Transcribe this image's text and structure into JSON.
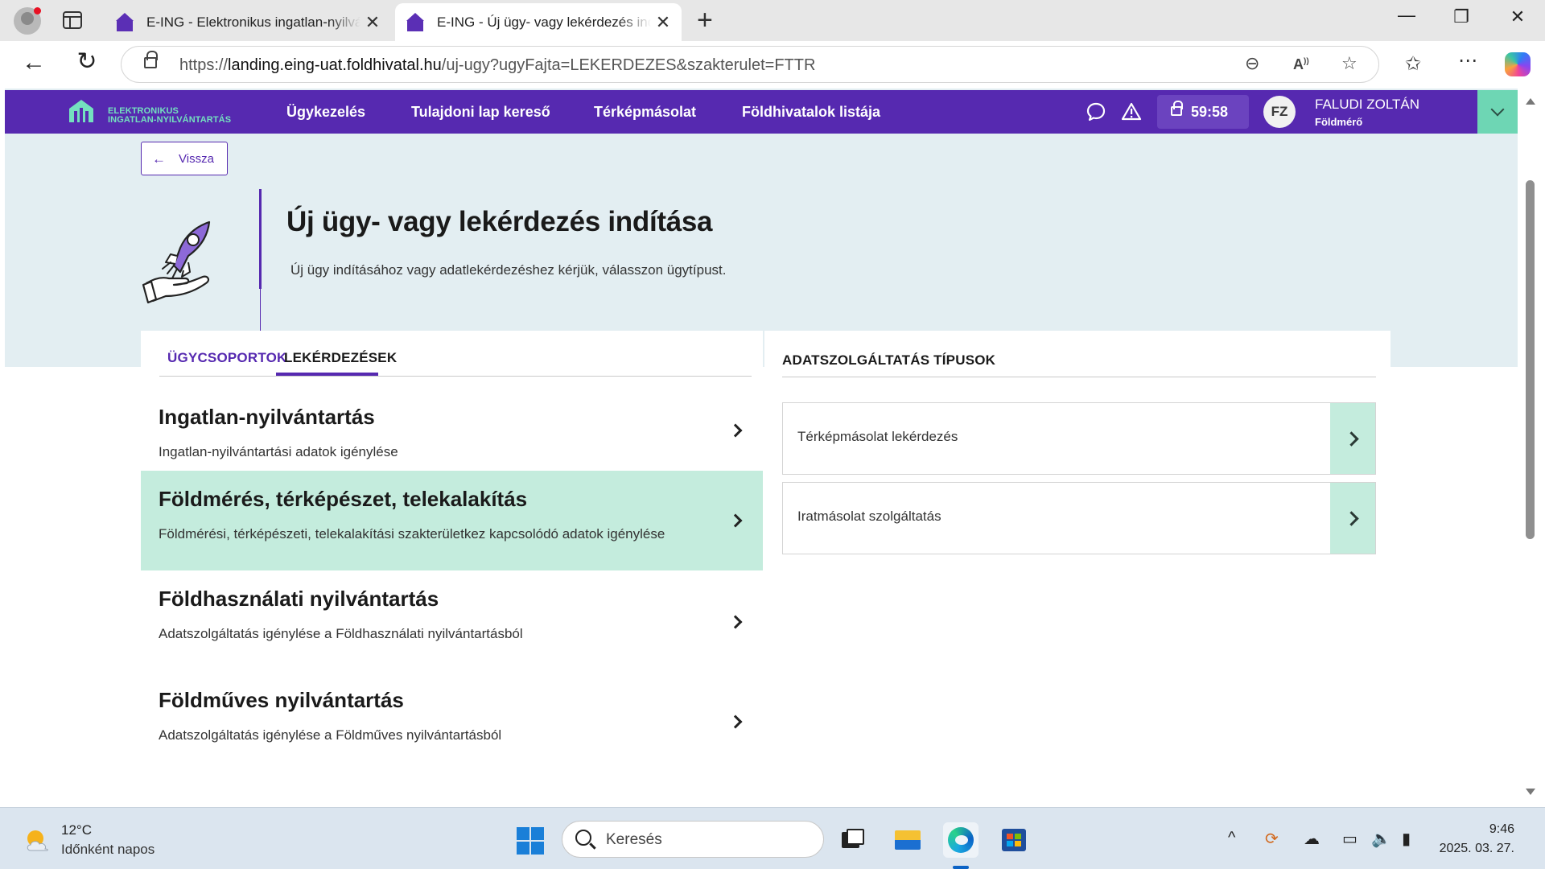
{
  "browser": {
    "tabs": [
      {
        "title": "E-ING - Elektronikus ingatlan-nyilvántartás",
        "active": false
      },
      {
        "title": "E-ING - Új ügy- vagy lekérdezés indítása",
        "active": true
      }
    ],
    "url_prefix": "https://",
    "url_domain": "landing.eing-uat.foldhivatal.hu",
    "url_path": "/uj-ugy?ugyFajta=LEKERDEZES&szakterulet=FTTR",
    "icons": [
      "profile-icon",
      "tab-actions-icon",
      "close-icon",
      "new-tab-icon",
      "minimize-icon",
      "restore-icon",
      "close-window-icon",
      "back-icon",
      "refresh-icon",
      "lock-icon",
      "zoom-out-icon",
      "read-aloud-icon",
      "favorite-icon",
      "favorites-icon",
      "more-icon",
      "copilot-icon"
    ]
  },
  "site": {
    "logo_line1": "ELEKTRONIKUS",
    "logo_line2": "INGATLAN-NYILVÁNTARTÁS",
    "nav": [
      "Ügykezelés",
      "Tulajdoni lap kereső",
      "Térképmásolat",
      "Földhivatalok listája"
    ],
    "timer": "59:58",
    "user_initials": "FZ",
    "user_name": "FALUDI ZOLTÁN",
    "user_role": "Földmérő",
    "accent": "#5629b0",
    "green": "#c4ecdd"
  },
  "page": {
    "back_label": "Vissza",
    "title": "Új ügy- vagy lekérdezés indítása",
    "subtitle": "Új ügy indításához vagy adatlekérdezéshez kérjük, válasszon ügytípust.",
    "tabs": [
      {
        "label": "ÜGYCSOPORTOK",
        "active": false
      },
      {
        "label": "LEKÉRDEZÉSEK",
        "active": true
      }
    ],
    "categories": [
      {
        "title": "Ingatlan-nyilvántartás",
        "desc": "Ingatlan-nyilvántartási adatok igénylése",
        "selected": false
      },
      {
        "title": "Földmérés, térképészet, telekalakítás",
        "desc": "Földmérési, térképészeti, telekalakítási szakterületkez kapcsolódó adatok igénylése",
        "selected": true
      },
      {
        "title": "Földhasználati nyilvántartás",
        "desc": "Adatszolgáltatás igénylése a Földhasználati nyilvántartásból",
        "selected": false
      },
      {
        "title": "Földműves nyilvántartás",
        "desc": "Adatszolgáltatás igénylése a Földműves nyilvántartásból",
        "selected": false
      }
    ],
    "right_heading": "ADATSZOLGÁLTATÁS TÍPUSOK",
    "services": [
      "Térképmásolat lekérdezés",
      "Iratmásolat szolgáltatás"
    ]
  },
  "taskbar": {
    "weather_temp": "12°C",
    "weather_desc": "Időnként napos",
    "search_placeholder": "Keresés",
    "time": "9:46",
    "date": "2025. 03. 27."
  }
}
